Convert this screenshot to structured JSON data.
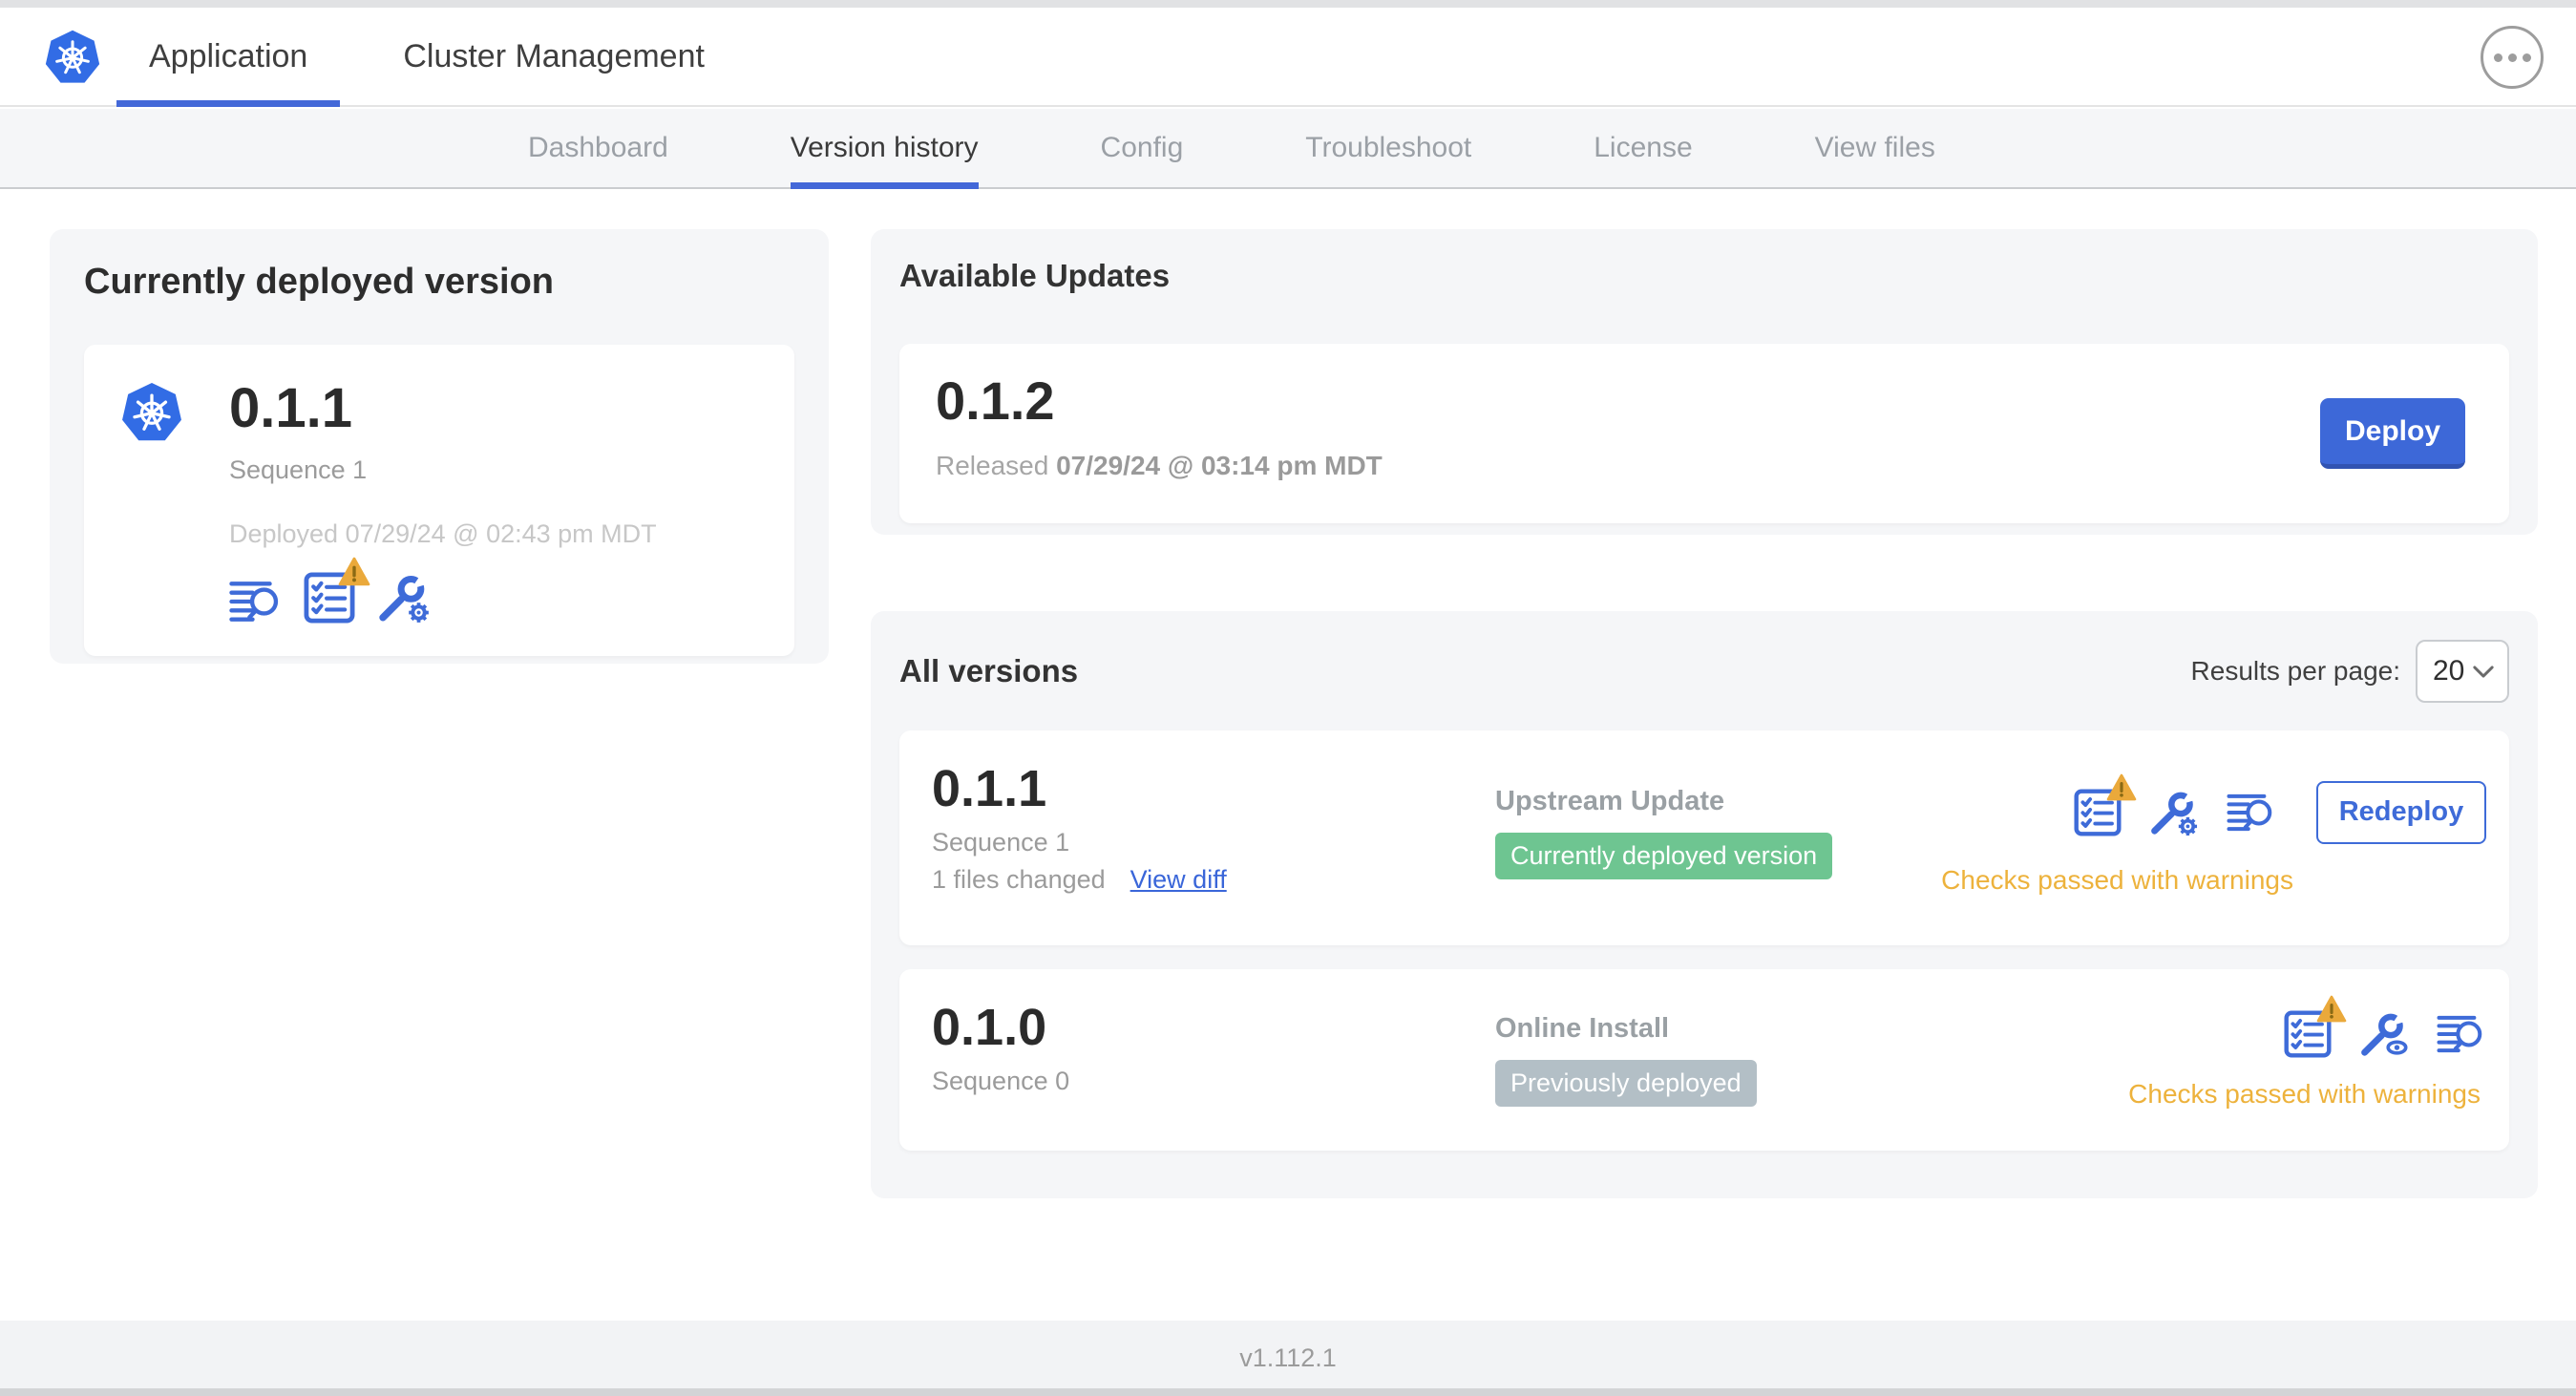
{
  "header": {
    "logo": "kubernetes-logo",
    "tabs": [
      {
        "label": "Application",
        "active": true
      },
      {
        "label": "Cluster Management",
        "active": false
      }
    ],
    "overflow_menu_icon": "ellipsis-icon"
  },
  "nav": {
    "tabs": [
      {
        "label": "Dashboard",
        "active": false
      },
      {
        "label": "Version history",
        "active": true
      },
      {
        "label": "Config",
        "active": false
      },
      {
        "label": "Troubleshoot",
        "active": false
      },
      {
        "label": "License",
        "active": false
      },
      {
        "label": "View files",
        "active": false
      }
    ]
  },
  "current_version_card": {
    "title": "Currently deployed version",
    "version": "0.1.1",
    "sequence": "Sequence 1",
    "deployed": "Deployed 07/29/24 @ 02:43 pm MDT",
    "icons": [
      "logs-icon",
      "preflight-checks-warning-icon",
      "wrench-gear-icon"
    ]
  },
  "available_updates": {
    "title": "Available Updates",
    "version": "0.1.2",
    "released_prefix": "Released ",
    "released_date": "07/29/24 @ 03:14 pm MDT",
    "deploy_label": "Deploy"
  },
  "all_versions": {
    "title": "All versions",
    "results_per_page_label": "Results per page:",
    "results_per_page_value": "20",
    "rows": [
      {
        "version": "0.1.1",
        "sequence": "Sequence 1",
        "files_changed": "1 files changed",
        "diff_link": "View diff",
        "source": "Upstream Update",
        "badge": "Currently deployed version",
        "badge_color": "#6ec591",
        "icons": [
          "preflight-checks-warning-icon",
          "wrench-gear-icon",
          "logs-icon"
        ],
        "status": "Checks passed with warnings",
        "action_label": "Redeploy"
      },
      {
        "version": "0.1.0",
        "sequence": "Sequence 0",
        "source": "Online Install",
        "badge": "Previously deployed",
        "badge_color": "#b3bfc6",
        "icons": [
          "preflight-checks-warning-icon",
          "wrench-eye-icon",
          "logs-icon"
        ],
        "status": "Checks passed with warnings"
      }
    ]
  },
  "footer": {
    "version": "v1.112.1"
  },
  "colors": {
    "accent_blue": "#3e6bd8",
    "kubernetes_blue": "#326ce5",
    "warning_orange": "#edb23c",
    "warning_triangle": "#eaa93b",
    "badge_green": "#6ec591",
    "badge_gray": "#b3bfc6",
    "section_bg": "#f5f6f8"
  }
}
